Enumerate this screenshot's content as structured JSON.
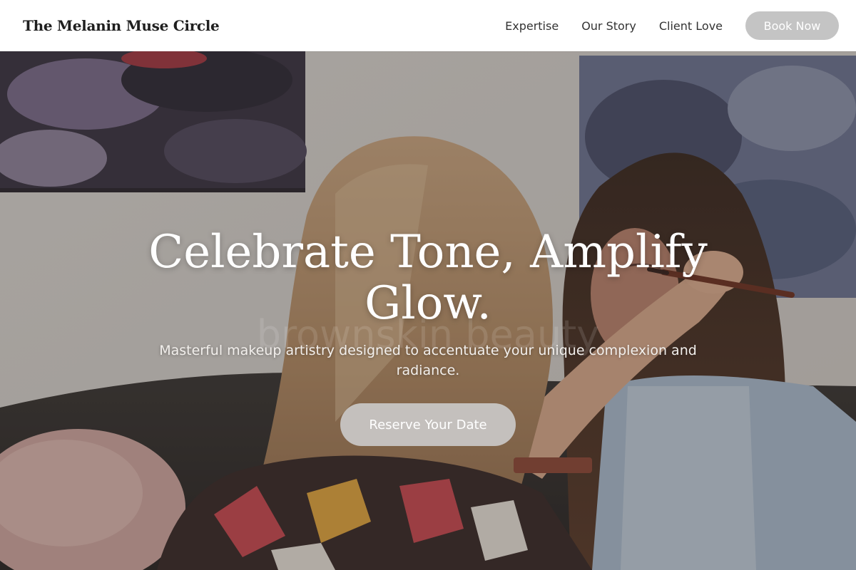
{
  "header": {
    "brand": "The Melanin Muse Circle",
    "nav": [
      {
        "label": "Expertise"
      },
      {
        "label": "Our Story"
      },
      {
        "label": "Client Love"
      }
    ],
    "cta_label": "Book Now"
  },
  "hero": {
    "title": "Celebrate Tone, Amplify Glow.",
    "subtitle": "Masterful makeup artistry designed to accentuate your unique complexion and radiance.",
    "cta_label": "Reserve Your Date",
    "watermark": "brownskin beauty",
    "photo_subject": "makeup-artist-applying-eyeshadow-photo"
  },
  "colors": {
    "header_bg": "#ffffff",
    "brand_text": "#1f1f1f",
    "nav_text": "#333333",
    "button_bg": "#c4c4c4",
    "hero_text": "#ffffff"
  }
}
